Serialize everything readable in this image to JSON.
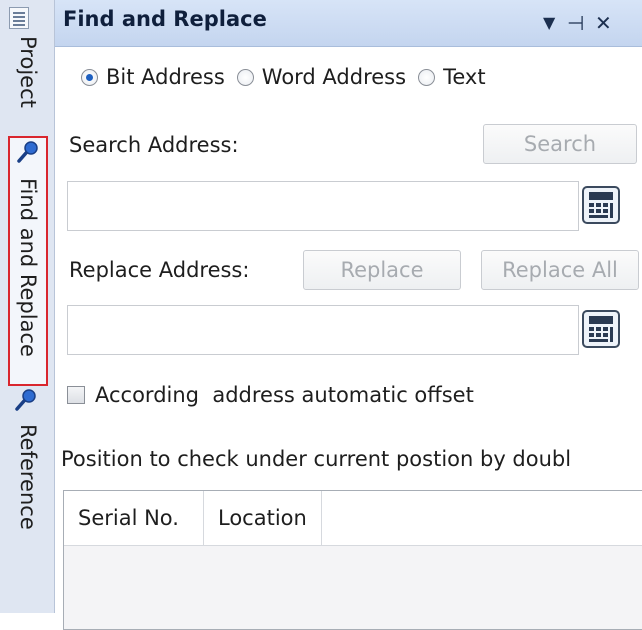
{
  "sidebar": {
    "tabs": [
      {
        "label": "Project",
        "icon": "project-icon"
      },
      {
        "label": "Find and Replace",
        "icon": "magnifier-icon",
        "active": true
      },
      {
        "label": "Reference",
        "icon": "magnifier-icon"
      }
    ]
  },
  "panel": {
    "title": "Find and Replace",
    "controls": {
      "dropdown": "▼",
      "pin": "⊣",
      "close": "✕"
    }
  },
  "search_mode": {
    "options": [
      "Bit Address",
      "Word Address",
      "Text"
    ],
    "selected": "Bit Address"
  },
  "search": {
    "label": "Search Address:",
    "button": "Search",
    "value": ""
  },
  "replace": {
    "label": "Replace Address:",
    "button": "Replace",
    "button_all": "Replace All",
    "value": ""
  },
  "offset_checkbox": {
    "label": "According  address automatic offset",
    "checked": false
  },
  "hint": "Position to check under current postion by doubl",
  "results_table": {
    "columns": [
      "Serial No.",
      "Location"
    ],
    "rows": []
  },
  "colors": {
    "title_bar": "#c9d8f0",
    "active_tab_border": "#d9262e",
    "radio_selected": "#1d5fc0",
    "disabled_text": "#a7abb0"
  }
}
